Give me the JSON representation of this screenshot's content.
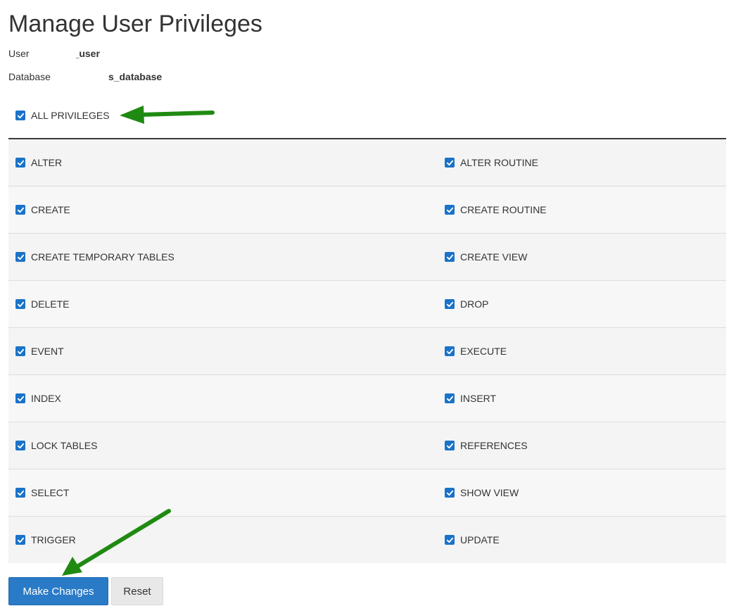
{
  "page": {
    "title": "Manage User Privileges",
    "user_label": "User",
    "user_value": "_user",
    "database_label": "Database",
    "database_value": "s_database"
  },
  "all_privileges": {
    "label": "ALL PRIVILEGES",
    "checked": true
  },
  "privileges": [
    {
      "left": "ALTER",
      "right": "ALTER ROUTINE"
    },
    {
      "left": "CREATE",
      "right": "CREATE ROUTINE"
    },
    {
      "left": "CREATE TEMPORARY TABLES",
      "right": "CREATE VIEW"
    },
    {
      "left": "DELETE",
      "right": "DROP"
    },
    {
      "left": "EVENT",
      "right": "EXECUTE"
    },
    {
      "left": "INDEX",
      "right": "INSERT"
    },
    {
      "left": "LOCK TABLES",
      "right": "REFERENCES"
    },
    {
      "left": "SELECT",
      "right": "SHOW VIEW"
    },
    {
      "left": "TRIGGER",
      "right": "UPDATE"
    }
  ],
  "buttons": {
    "make_changes": "Make Changes",
    "reset": "Reset"
  },
  "colors": {
    "checkbox": "#1a73c8",
    "primary_button": "#2a7bc7",
    "annotation_arrow": "#1f8a12"
  },
  "icons": {
    "checkbox": "checkmark-icon",
    "annotation": "green-arrow-icon"
  }
}
